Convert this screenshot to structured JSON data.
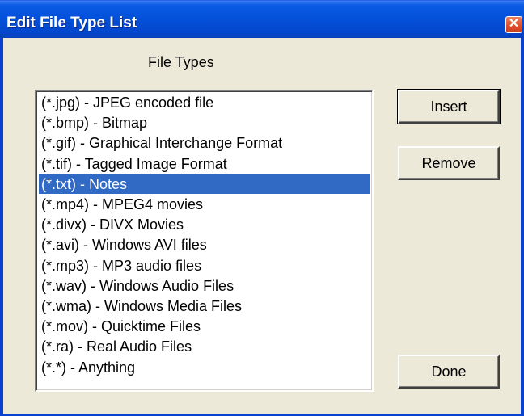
{
  "window": {
    "title": "Edit File Type List",
    "close_glyph": "✕"
  },
  "file_types_label": "File Types",
  "file_types": [
    {
      "label": "(*.jpg) - JPEG encoded file",
      "selected": false
    },
    {
      "label": "(*.bmp) - Bitmap",
      "selected": false
    },
    {
      "label": "(*.gif) - Graphical Interchange Format",
      "selected": false
    },
    {
      "label": "(*.tif) - Tagged Image Format",
      "selected": false
    },
    {
      "label": "(*.txt) - Notes",
      "selected": true
    },
    {
      "label": "(*.mp4) - MPEG4 movies",
      "selected": false
    },
    {
      "label": "(*.divx) - DIVX Movies",
      "selected": false
    },
    {
      "label": "(*.avi) - Windows AVI files",
      "selected": false
    },
    {
      "label": "(*.mp3) - MP3 audio files",
      "selected": false
    },
    {
      "label": "(*.wav) - Windows Audio Files",
      "selected": false
    },
    {
      "label": "(*.wma) - Windows Media Files",
      "selected": false
    },
    {
      "label": "(*.mov) - Quicktime Files",
      "selected": false
    },
    {
      "label": "(*.ra) - Real Audio Files",
      "selected": false
    },
    {
      "label": "(*.*) - Anything",
      "selected": false
    }
  ],
  "buttons": {
    "insert": "Insert",
    "remove": "Remove",
    "done": "Done"
  },
  "colors": {
    "selection": "#316ac5",
    "dialog_face": "#ece9d8",
    "titlebar": "#0450d8",
    "close_button": "#e0522f"
  }
}
